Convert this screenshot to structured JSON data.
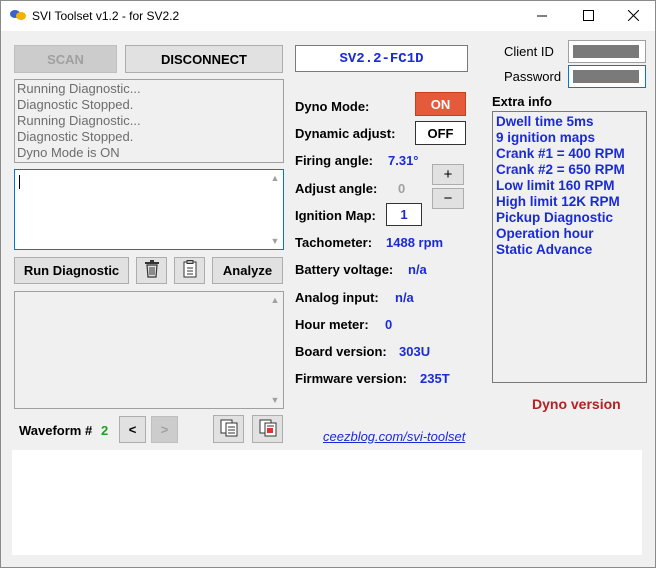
{
  "window": {
    "title": "SVI Toolset v1.2 - for SV2.2"
  },
  "toolbar": {
    "scan_label": "SCAN",
    "disconnect_label": "DISCONNECT"
  },
  "device_id": "SV2.2-FC1D",
  "auth": {
    "client_id_label": "Client ID",
    "password_label": "Password"
  },
  "log_lines": [
    "Running Diagnostic...",
    "Diagnostic Stopped.",
    "Running Diagnostic...",
    "Diagnostic Stopped.",
    "Dyno Mode is ON"
  ],
  "actions": {
    "run_diagnostic_label": "Run Diagnostic",
    "analyze_label": "Analyze"
  },
  "settings": {
    "dyno_mode_label": "Dyno Mode:",
    "dyno_mode_value": "ON",
    "dynamic_adjust_label": "Dynamic adjust:",
    "dynamic_adjust_value": "OFF",
    "firing_angle_label": "Firing angle:",
    "firing_angle_value": "7.31°",
    "adjust_angle_label": "Adjust angle:",
    "adjust_angle_value": "0",
    "ignition_map_label": "Ignition Map:",
    "ignition_map_value": "1",
    "plus_label": "+",
    "minus_label": "−"
  },
  "readings": {
    "tachometer_label": "Tachometer:",
    "tachometer_value": "1488 rpm",
    "battery_label": "Battery voltage:",
    "battery_value": "n/a",
    "analog_label": "Analog input:",
    "analog_value": "n/a",
    "hour_label": "Hour meter:",
    "hour_value": "0",
    "board_label": "Board version:",
    "board_value": "303U",
    "firmware_label": "Firmware version:",
    "firmware_value": "235T"
  },
  "extra_info": {
    "title": "Extra info",
    "items": [
      "Dwell time 5ms",
      "9 ignition maps",
      "Crank #1 = 400 RPM",
      "Crank #2 = 650 RPM",
      "Low limit 160 RPM",
      "High limit 12K RPM",
      "Pickup Diagnostic",
      "Operation hour",
      "Static Advance"
    ]
  },
  "dyno_version_label": "Dyno version",
  "waveform": {
    "label": "Waveform #",
    "number": "2",
    "prev_label": "<",
    "next_label": ">"
  },
  "link_text": "ceezblog.com/svi-toolset",
  "colors": {
    "on_button": "#e65a3c",
    "value_blue": "#1a2bd6",
    "dyno_version": "#b22222",
    "waveform_number": "#22a022"
  }
}
